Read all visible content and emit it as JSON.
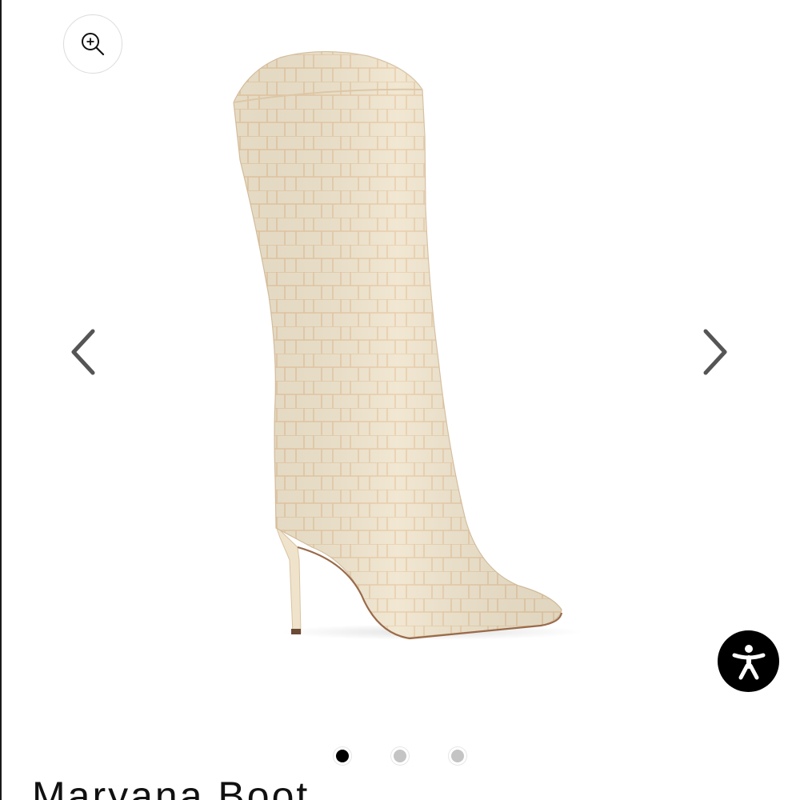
{
  "product": {
    "title": "Maryana Boot",
    "image_description_icon": "boot-photo"
  },
  "gallery": {
    "zoom_icon": "zoom-in-icon",
    "prev_icon": "chevron-left-icon",
    "next_icon": "chevron-right-icon",
    "slide_count": 3,
    "active_slide": 1
  },
  "accessibility": {
    "icon": "accessibility-icon"
  },
  "colors": {
    "boot_leather": "#efe4cc",
    "boot_scale_line": "#e8c9a6",
    "arrow": "#555555",
    "dot_active": "#000000",
    "dot_inactive": "#c4c4c4",
    "a11y_bg": "#000000"
  }
}
